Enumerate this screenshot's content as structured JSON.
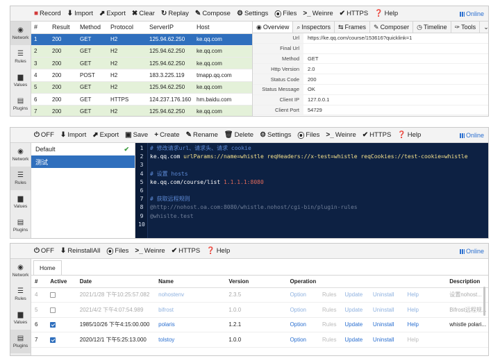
{
  "side": {
    "network": "Network",
    "rules": "Rules",
    "values": "Values",
    "plugins": "Plugins"
  },
  "online": "Online",
  "panel1": {
    "toolbar": [
      "Record",
      "Import",
      "Export",
      "Clear",
      "Replay",
      "Compose",
      "Settings",
      "Files",
      "Weinre",
      "HTTPS",
      "Help"
    ],
    "columns": [
      "#",
      "Result",
      "Method",
      "Protocol",
      "ServerIP",
      "Host"
    ],
    "rows": [
      [
        "1",
        "200",
        "GET",
        "H2",
        "125.94.62.250",
        "ke.qq.com"
      ],
      [
        "2",
        "200",
        "GET",
        "H2",
        "125.94.62.250",
        "ke.qq.com"
      ],
      [
        "3",
        "200",
        "GET",
        "H2",
        "125.94.62.250",
        "ke.qq.com"
      ],
      [
        "4",
        "200",
        "POST",
        "H2",
        "183.3.225.119",
        "tmapp.qq.com"
      ],
      [
        "5",
        "200",
        "GET",
        "H2",
        "125.94.62.250",
        "ke.qq.com"
      ],
      [
        "6",
        "200",
        "GET",
        "HTTPS",
        "124.237.176.160",
        "hm.baidu.com"
      ],
      [
        "7",
        "200",
        "GET",
        "H2",
        "125.94.62.250",
        "ke.qq.com"
      ]
    ],
    "tabs": [
      "Overview",
      "Inspectors",
      "Frames",
      "Composer",
      "Timeline",
      "Tools"
    ],
    "overview": [
      {
        "k": "Url",
        "v": "https://ke.qq.com/course/153616?quicklink=1"
      },
      {
        "k": "Final Url",
        "v": ""
      },
      {
        "k": "Method",
        "v": "GET"
      },
      {
        "k": "Http Version",
        "v": "2.0"
      },
      {
        "k": "Status Code",
        "v": "200"
      },
      {
        "k": "Status Message",
        "v": "OK"
      },
      {
        "k": "Client IP",
        "v": "127.0.0.1"
      },
      {
        "k": "Client Port",
        "v": "54729"
      }
    ]
  },
  "panel2": {
    "toolbar": [
      "OFF",
      "Import",
      "Export",
      "Save",
      "Create",
      "Rename",
      "Delete",
      "Settings",
      "Files",
      "Weinre",
      "HTTPS",
      "Help"
    ],
    "list": [
      "Default",
      "测试"
    ],
    "lines": [
      {
        "n": "1",
        "parts": [
          {
            "c": "c-com",
            "t": "# 修改请求url、请求头、请求 cookie"
          }
        ]
      },
      {
        "n": "2",
        "parts": [
          {
            "c": "c-host",
            "t": "ke.qq.com "
          },
          {
            "c": "c-key",
            "t": "urlParams://name=whistle reqHeaders://x-test=whistle reqCookies://test-cookie=whistle"
          }
        ]
      },
      {
        "n": "3",
        "parts": []
      },
      {
        "n": "4",
        "parts": [
          {
            "c": "c-com",
            "t": "# 设置 hosts"
          }
        ]
      },
      {
        "n": "5",
        "parts": [
          {
            "c": "c-host",
            "t": "ke.qq.com/course/list "
          },
          {
            "c": "c-ip",
            "t": "1.1.1.1:8080"
          }
        ]
      },
      {
        "n": "6",
        "parts": []
      },
      {
        "n": "7",
        "parts": [
          {
            "c": "c-com",
            "t": "# 获取远程规则"
          }
        ]
      },
      {
        "n": "8",
        "parts": [
          {
            "c": "c-url",
            "t": "@http://nohost.oa.com:8080/whistle.nohost/cgi-bin/plugin-rules"
          }
        ]
      },
      {
        "n": "9",
        "parts": [
          {
            "c": "c-url",
            "t": "@whislte.test"
          }
        ]
      },
      {
        "n": "10",
        "parts": []
      }
    ]
  },
  "panel3": {
    "toolbar": [
      "OFF",
      "ReinstallAll",
      "Files",
      "Weinre",
      "HTTPS",
      "Help"
    ],
    "tab": "Home",
    "columns": [
      "#",
      "Active",
      "Date",
      "Name",
      "Version",
      "Operation",
      "",
      "",
      "",
      "",
      "Description"
    ],
    "rows": [
      {
        "n": "4",
        "active": false,
        "disabled": true,
        "date": "2021/1/28 下午10:25:57.082",
        "name": "nohostenv",
        "version": "2.3.5",
        "desc": "设置nohost..."
      },
      {
        "n": "5",
        "active": false,
        "disabled": true,
        "date": "2021/4/2 下午4:07:54.989",
        "name": "bifrost",
        "version": "1.0.0",
        "desc": "Bifrost远程规..."
      },
      {
        "n": "6",
        "active": true,
        "disabled": false,
        "date": "1985/10/26 下午4:15:00.000",
        "name": "polaris",
        "version": "1.2.1",
        "desc": "whistle polari..."
      },
      {
        "n": "7",
        "active": true,
        "disabled": false,
        "date": "2020/12/1 下午5:25:13.000",
        "name": "tolstoy",
        "version": "1.0.0",
        "desc": ""
      }
    ],
    "ops": [
      "Option",
      "Rules",
      "Update",
      "Uninstall",
      "Help"
    ]
  }
}
